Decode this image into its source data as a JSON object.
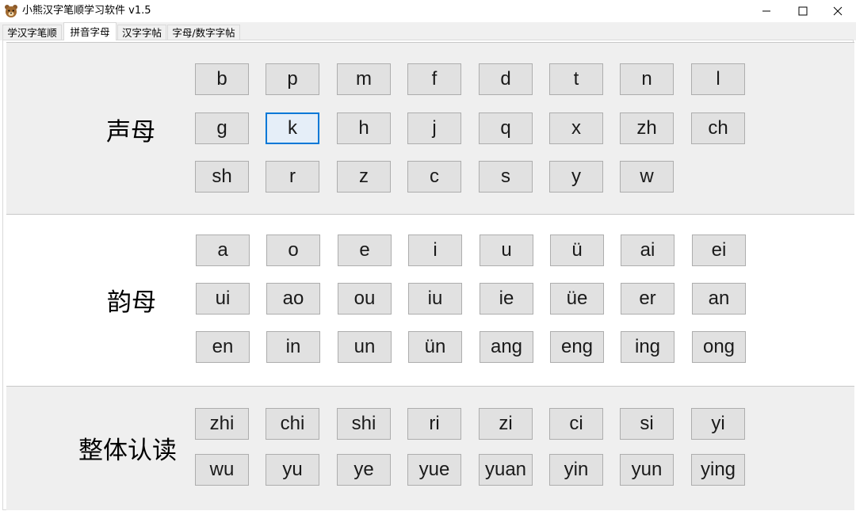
{
  "window": {
    "title": "小熊汉字笔顺学习软件 v1.5",
    "icon": "bear-icon"
  },
  "tabs": [
    {
      "label": "学汉字笔顺"
    },
    {
      "label": "拼音字母"
    },
    {
      "label": "汉字字帖"
    },
    {
      "label": "字母/数字字帖"
    }
  ],
  "active_tab": "拼音字母",
  "sections": {
    "initials": {
      "label": "声母",
      "keys": [
        "b",
        "p",
        "m",
        "f",
        "d",
        "t",
        "n",
        "l",
        "g",
        "k",
        "h",
        "j",
        "q",
        "x",
        "zh",
        "ch",
        "sh",
        "r",
        "z",
        "c",
        "s",
        "y",
        "w"
      ]
    },
    "finals": {
      "label": "韵母",
      "keys": [
        "a",
        "o",
        "e",
        "i",
        "u",
        "ü",
        "ai",
        "ei",
        "ui",
        "ao",
        "ou",
        "iu",
        "ie",
        "üe",
        "er",
        "an",
        "en",
        "in",
        "un",
        "ün",
        "ang",
        "eng",
        "ing",
        "ong"
      ]
    },
    "whole": {
      "label": "整体认读",
      "keys": [
        "zhi",
        "chi",
        "shi",
        "ri",
        "zi",
        "ci",
        "si",
        "yi",
        "wu",
        "yu",
        "ye",
        "yue",
        "yuan",
        "yin",
        "yun",
        "ying"
      ]
    }
  },
  "focused_key": "k",
  "colors": {
    "focus_border": "#0078d7",
    "key_bg": "#e1e1e1",
    "section_gray": "#efefef"
  }
}
